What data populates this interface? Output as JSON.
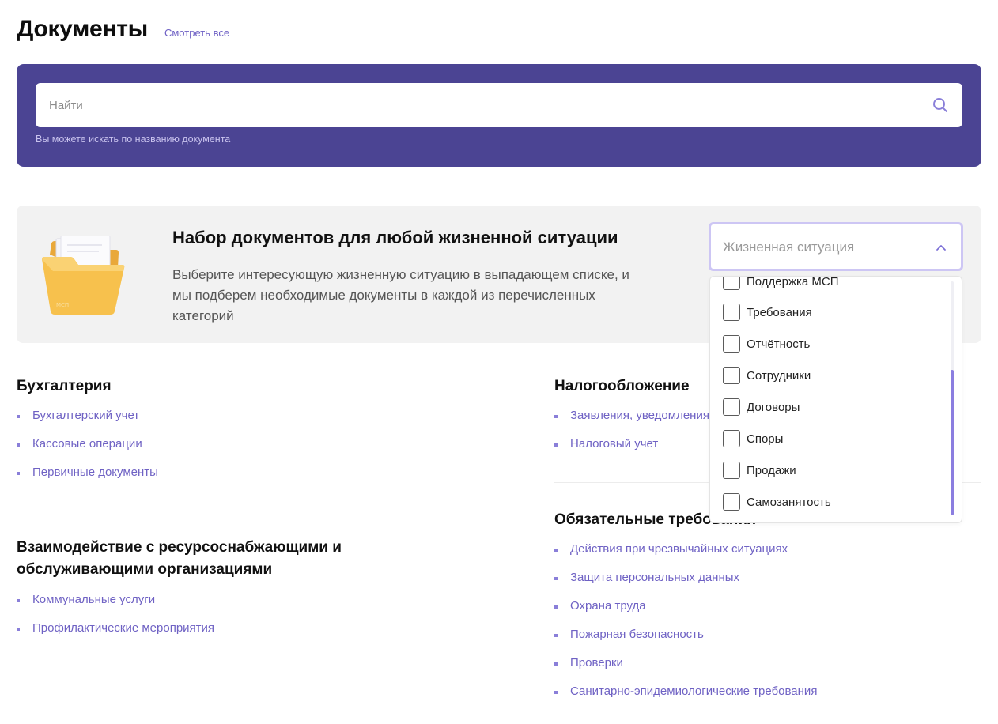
{
  "header": {
    "title": "Документы",
    "see_all": "Смотреть все"
  },
  "search": {
    "placeholder": "Найти",
    "hint": "Вы можете искать по названию документа",
    "icon": "search-icon"
  },
  "promo": {
    "title": "Набор документов для любой жизненной ситуации",
    "text": "Выберите интересующую жизненную ситуацию в выпадающем списке, и мы подберем необходимые документы в каждой из перечисленных категорий",
    "illustration": "folder-icon"
  },
  "situation_select": {
    "placeholder": "Жизненная ситуация",
    "icon": "chevron-up-icon",
    "options": [
      "Поддержка МСП",
      "Требования",
      "Отчётность",
      "Сотрудники",
      "Договоры",
      "Споры",
      "Продажи",
      "Самозанятость"
    ]
  },
  "sections": {
    "accounting": {
      "title": "Бухгалтерия",
      "links": [
        "Бухгалтерский учет",
        "Кассовые операции",
        "Первичные документы"
      ]
    },
    "utilities": {
      "title": "Взаимодействие с ресурсоснабжающими и обслуживающими организациями",
      "links": [
        "Коммунальные услуги",
        "Профилактические мероприятия"
      ]
    },
    "taxation": {
      "title": "Налогообложение",
      "links": [
        "Заявления, уведомления",
        "Налоговый учет"
      ]
    },
    "requirements": {
      "title": "Обязательные требования",
      "links": [
        "Действия при чрезвычайных ситуациях",
        "Защита персональных данных",
        "Охрана труда",
        "Пожарная безопасность",
        "Проверки",
        "Санитарно-эпидемиологические требования"
      ]
    }
  },
  "colors": {
    "accent": "#4b4493",
    "link": "#6f62c4",
    "promo_bg": "#f2f2f2",
    "select_border": "#cdc6f4"
  }
}
